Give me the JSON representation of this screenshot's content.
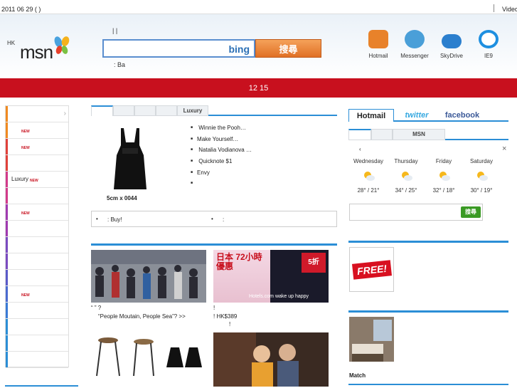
{
  "topbar": {
    "date": "2011 06 29 (   )",
    "right_link": "Video"
  },
  "logo": {
    "region": "HK",
    "brand": "msn"
  },
  "search": {
    "top_links": "|    |",
    "engine": "bing",
    "button": "搜尋",
    "below_links": ":              Ba"
  },
  "services": [
    {
      "name": "Hotmail",
      "color": "#e8822a"
    },
    {
      "name": "Messenger",
      "color": "#4a9fd8"
    },
    {
      "name": "SkyDrive",
      "color": "#2b7fce"
    },
    {
      "name": "IE9",
      "color": "#1e8fe0"
    }
  ],
  "banner": {
    "text": "12 15"
  },
  "leftnav": {
    "items": [
      {
        "label": "",
        "new": "",
        "color": "#f08a20",
        "chev": "›"
      },
      {
        "label": "",
        "new": "NEW",
        "color": "#f08a20",
        "chev": ""
      },
      {
        "label": "",
        "new": "NEW",
        "color": "#e0403a",
        "chev": ""
      },
      {
        "label": "",
        "new": "",
        "color": "#e0403a",
        "chev": ""
      },
      {
        "label": "Luxury",
        "new": "NEW",
        "color": "#d23a8a",
        "chev": ""
      },
      {
        "label": "",
        "new": "",
        "color": "#d23a8a",
        "chev": ""
      },
      {
        "label": "",
        "new": "NEW",
        "color": "#a03ab0",
        "chev": ""
      },
      {
        "label": "",
        "new": "",
        "color": "#a03ab0",
        "chev": ""
      },
      {
        "label": "",
        "new": "",
        "color": "#7a4ac0",
        "chev": ""
      },
      {
        "label": "",
        "new": "",
        "color": "#7a4ac0",
        "chev": ""
      },
      {
        "label": "",
        "new": "",
        "color": "#5a5ac8",
        "chev": ""
      },
      {
        "label": "",
        "new": "NEW",
        "color": "#4a6ad0",
        "chev": ""
      },
      {
        "label": "",
        "new": "",
        "color": "#3a7ad6",
        "chev": ""
      },
      {
        "label": "",
        "new": "",
        "color": "#2b8ed6",
        "chev": ""
      },
      {
        "label": "",
        "new": "",
        "color": "#2b8ed6",
        "chev": ""
      },
      {
        "label": "",
        "new": "",
        "color": "#2b8ed6",
        "chev": ""
      }
    ]
  },
  "main_tabs": [
    "",
    "",
    "",
    "",
    "Luxury"
  ],
  "fashion": {
    "caption": "5cm x 0044",
    "feed": [
      "          Winnie the Pooh…",
      "Make Yourself…",
      "   Natalia Vodianova       …",
      "  Quicknote         $1",
      "Envy",
      ""
    ],
    "promo_left": ":        Buy!",
    "promo_right": ":"
  },
  "stories": {
    "s1_caption_a": "“      ”              ?",
    "s1_caption_b": "“People Moutain, People Sea”?          >>",
    "s2_caption_a": "                   !",
    "s2_caption_b": "              !                    HK$389",
    "s2_caption_c": "!",
    "s2_hotels": "Hotels.com wake up happy",
    "s2_deal": "5折",
    "s2_title": "日本 72小時優惠"
  },
  "right_tabs": [
    "Hotmail",
    "twitter",
    "facebook"
  ],
  "weather": {
    "tabs": [
      "",
      "",
      "MSN"
    ],
    "location": "‹",
    "close": "×",
    "days": [
      {
        "day": "Wednesday",
        "temp": "28° / 21°"
      },
      {
        "day": "Thursday",
        "temp": "34° / 25°"
      },
      {
        "day": "Friday",
        "temp": "32° / 18°"
      },
      {
        "day": "Saturday",
        "temp": "30° / 19°"
      }
    ]
  },
  "right_search": {
    "button": "搜尋"
  },
  "ad": {
    "text": "FREE!"
  },
  "match": {
    "label": "Match"
  }
}
